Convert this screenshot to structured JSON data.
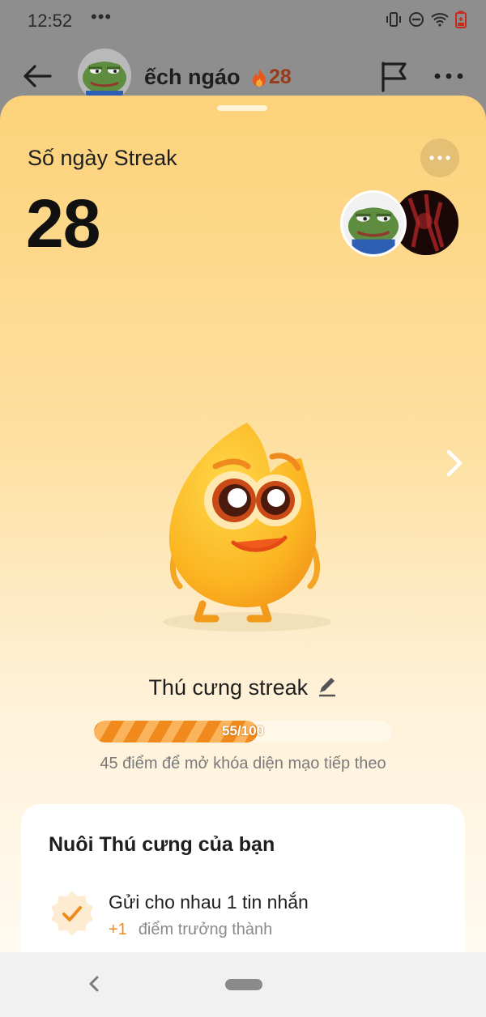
{
  "status_bar": {
    "time": "12:52",
    "more": "•••"
  },
  "header": {
    "contact_name": "ếch ngáo",
    "streak_count": "28"
  },
  "sheet": {
    "title": "Số ngày Streak",
    "streak_days": "28",
    "more": "•••",
    "pet_name": "Thú cưng streak",
    "progress": {
      "value": 55,
      "max": 100,
      "label": "55/100"
    },
    "progress_caption": "45 điểm để mở khóa diện mạo tiếp theo",
    "card": {
      "title": "Nuôi Thú cưng của bạn",
      "tasks": [
        {
          "label": "Gửi cho nhau 1 tin nhắn",
          "points": "+1",
          "points_label": "điểm trưởng thành"
        }
      ]
    }
  },
  "colors": {
    "accent": "#f08a1c",
    "sheet_top": "#fdd27a",
    "streak_fire": "#e8571c"
  },
  "icons": [
    "back-arrow-icon",
    "fire-icon",
    "flag-icon",
    "more-icon",
    "chevron-right-icon",
    "edit-pencil-icon",
    "check-badge-icon",
    "nav-back-icon"
  ]
}
